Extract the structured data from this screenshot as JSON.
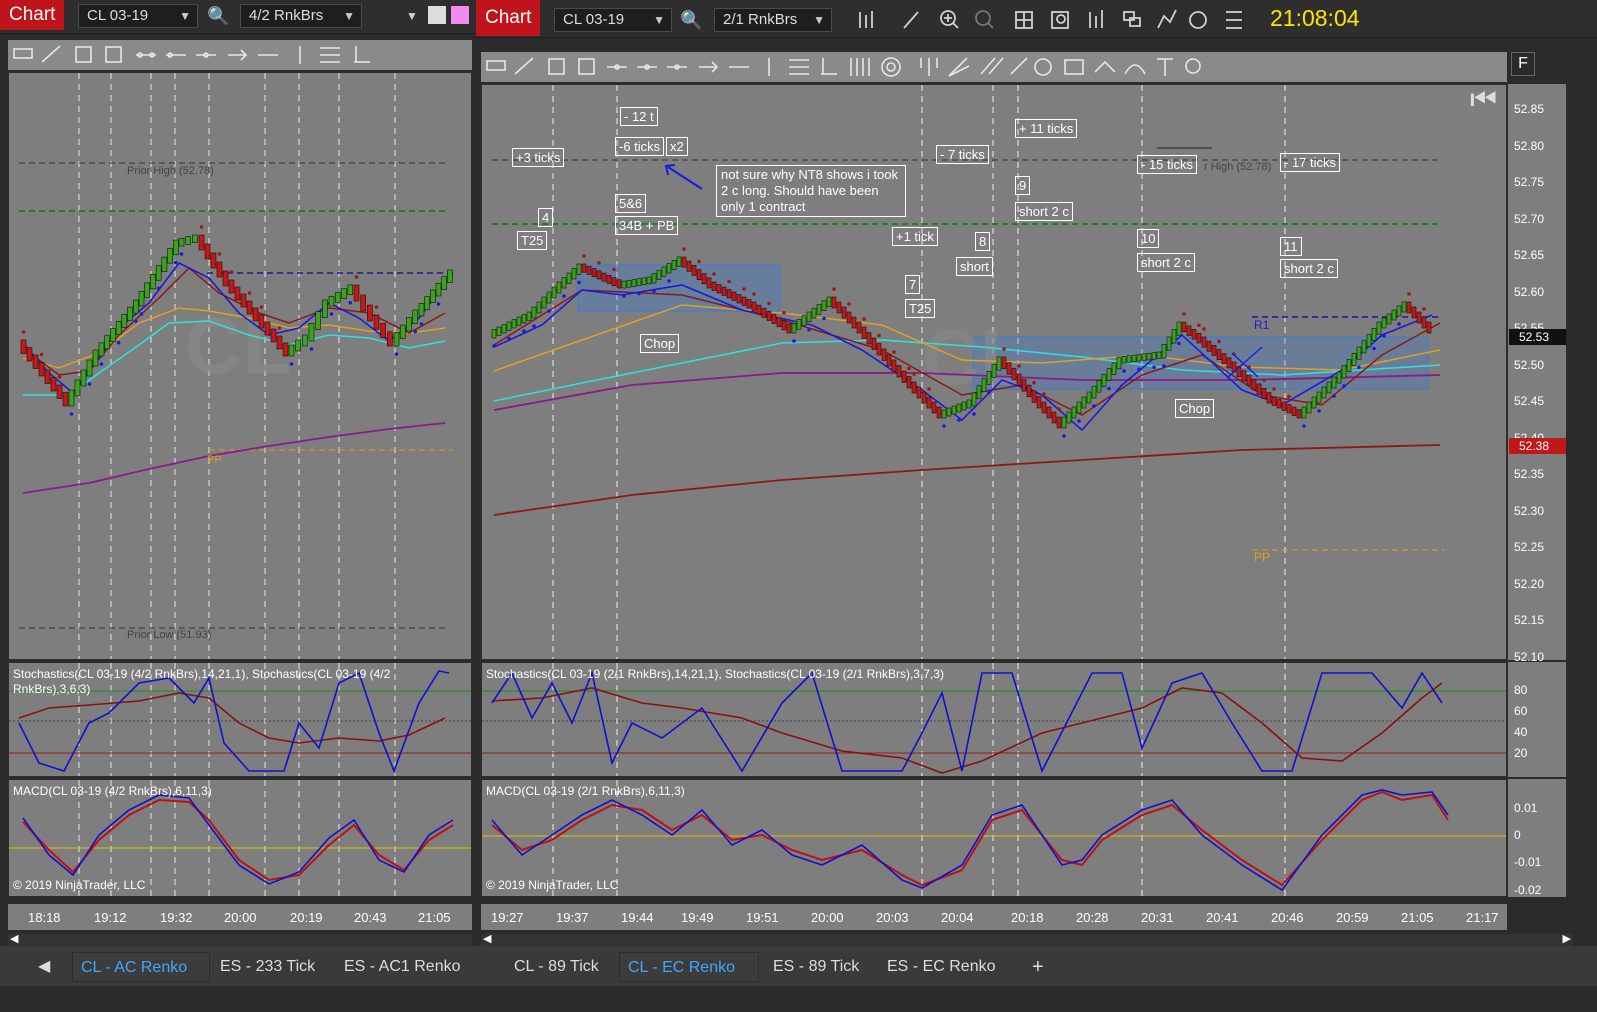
{
  "colors": {
    "accent_red": "#c0141c",
    "chart_bg": "#7e7e7e",
    "up_bar": "#39a61a",
    "down_bar": "#cc1515",
    "clock": "#ffe400",
    "active_tab": "#3da8ff"
  },
  "left": {
    "chart_btn": "Chart",
    "instrument": "CL 03-19",
    "bar_type": "4/2 RnkBrs",
    "labels": {
      "prior_high": "Prior High (52.78)",
      "prior_low": "Prior Low (51.93)",
      "pp": "PP",
      "watermark": "CL"
    },
    "stoch_title": "Stochastics(CL 03-19 (4/2 RnkBrs),14,21,1), Stochastics(CL 03-19 (4/2 RnkBrs),3,6,3)",
    "macd_title": "MACD(CL 03-19 (4/2 RnkBrs),6,11,3)",
    "copyright": "© 2019 NinjaTrader, LLC",
    "x_labels": [
      "18:18",
      "19:12",
      "19:32",
      "20:00",
      "20:19",
      "20:43",
      "21:05"
    ],
    "tabs": [
      "CL - AC Renko",
      "ES - 233 Tick",
      "ES - AC1 Renko"
    ]
  },
  "right": {
    "chart_btn": "Chart",
    "instrument": "CL 03-19",
    "bar_type": "2/1 RnkBrs",
    "clock": "21:08:04",
    "price_labels": [
      "52.85",
      "52.80",
      "52.75",
      "52.70",
      "52.65",
      "52.60",
      "52.55",
      "52.50",
      "52.45",
      "52.40",
      "52.35",
      "52.30",
      "52.25",
      "52.20",
      "52.15",
      "52.10"
    ],
    "price_tags": {
      "last": "52.53",
      "low": "52.38"
    },
    "stoch_labels": [
      "80",
      "60",
      "40",
      "20"
    ],
    "macd_labels": [
      "0.01",
      "0",
      "-0.01",
      "-0.02"
    ],
    "stoch_title": "Stochastics(CL 03-19 (2/1 RnkBrs),14,21,1), Stochastics(CL 03-19 (2/1 RnkBrs),3,7,3)",
    "macd_title": "MACD(CL 03-19 (2/1 RnkBrs),6,11,3)",
    "copyright": "© 2019 NinjaTrader, LLC",
    "x_labels": [
      "19:27",
      "19:37",
      "19:44",
      "19:49",
      "19:51",
      "20:00",
      "20:03",
      "20:04",
      "20:18",
      "20:28",
      "20:31",
      "20:41",
      "20:46",
      "20:59",
      "21:05",
      "21:17"
    ],
    "labels": {
      "prior_high": "r High (52.78)",
      "r1": "R1",
      "pp": "PP",
      "watermark": "CL",
      "f_button": "F"
    },
    "annotations": {
      "a1": "+3 ticks",
      "a2": "4",
      "a3": "T25",
      "a4": "- 12 t",
      "a5": "-6 ticks",
      "a6": "x2",
      "a7": "5&6",
      "a8": "34B + PB",
      "note": "not sure why NT8 shows\ni took 2 c long. Should have\nbeen only 1 contract",
      "a9": "Chop",
      "a10": "- 7 ticks",
      "a11": "+1 tick",
      "a12": "7",
      "a13": "T25",
      "a14": "8",
      "a15": "short",
      "a16": "+ 11 ticks",
      "a17": "9",
      "a18": "short 2 c",
      "a19": "- 15 ticks",
      "a20": "10",
      "a21": "short 2 c",
      "a22": "- 17 ticks",
      "a23": "11",
      "a24": "short 2 c",
      "a25": "Chop"
    },
    "tabs": [
      "CL - 89 Tick",
      "CL - EC Renko",
      "ES - 89 Tick",
      "ES - EC Renko"
    ],
    "add_tab": "+"
  }
}
